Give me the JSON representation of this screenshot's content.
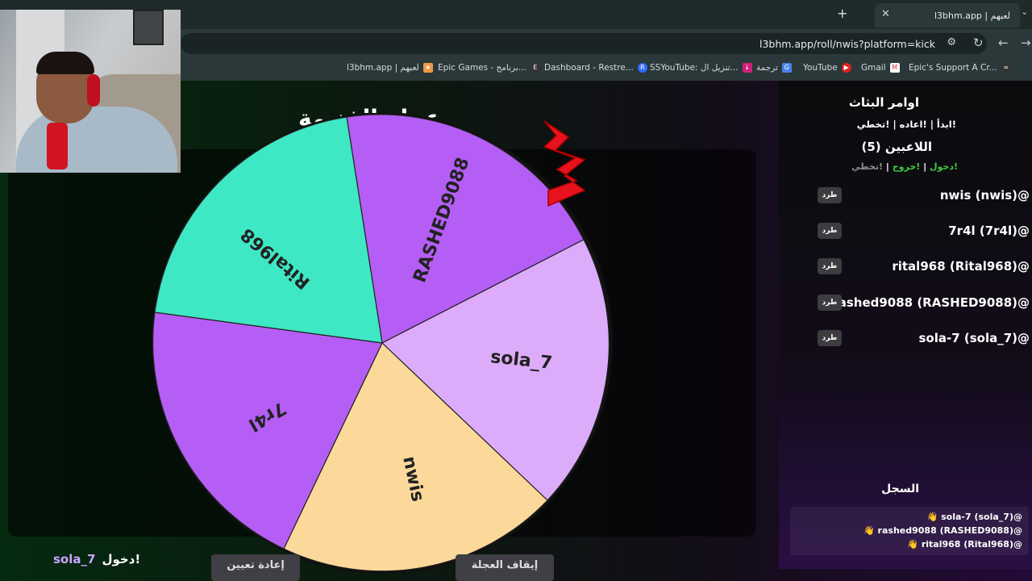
{
  "browser": {
    "tab_title": "l3bhm.app | لعبهم",
    "new_tab": "+",
    "url": "l3bhm.app/roll/nwis?platform=kick",
    "bookmarks": [
      {
        "label": "l3bhm.app | لعبهم",
        "icon": "site-icon"
      },
      {
        "label": "Epic Games - برنامج...",
        "icon": "epic-icon"
      },
      {
        "label": "Dashboard - Restre...",
        "icon": "restream-icon"
      },
      {
        "label": "SSYouTube: تنزيل ال...",
        "icon": "ssyoutube-icon"
      },
      {
        "label": "ترجمة",
        "icon": "translate-icon"
      },
      {
        "label": "YouTube",
        "icon": "youtube-icon"
      },
      {
        "label": "Gmail",
        "icon": "gmail-icon"
      },
      {
        "label": "Epic's Support A Cr...",
        "icon": "epic-support-icon"
      }
    ]
  },
  "wheel": {
    "title": "عجلة الفنيمة",
    "segments": [
      {
        "name": "RASHED9088",
        "color": "#b55ef5"
      },
      {
        "name": "sola_7",
        "color": "#dcacfa"
      },
      {
        "name": "nwis",
        "color": "#fcd99a"
      },
      {
        "name": "7r4l",
        "color": "#b55ef5"
      },
      {
        "name": "Rital968",
        "color": "#3fe8c4"
      }
    ]
  },
  "sidebar": {
    "commands_title": "اوامر البثاث",
    "commands": "!ابدأ | !اعاده | !تخطي",
    "players_title": "اللاعبين (5)",
    "legend": {
      "enter": "!دخول",
      "exit": "!خروج",
      "skip": "!تخطي",
      "sep": " | "
    },
    "kick_label": "طرد",
    "players": [
      "nwis (nwis)@",
      "7r4l (7r4l)@",
      "rital968 (Rital968)@",
      "rashed9088 (RASHED9088)@",
      "sola-7 (sola_7)@"
    ],
    "log_title": "السجل",
    "log": [
      "👋 sola-7 (sola_7)@",
      "👋 rashed9088 (RASHED9088)@",
      "👋 rital968 (Rital968)@"
    ]
  },
  "footer": {
    "enter_user": "sola_7",
    "enter_text": "دخول!",
    "reset_button": "إعادة تعيين",
    "stop_button": "إيقاف العجلة"
  }
}
